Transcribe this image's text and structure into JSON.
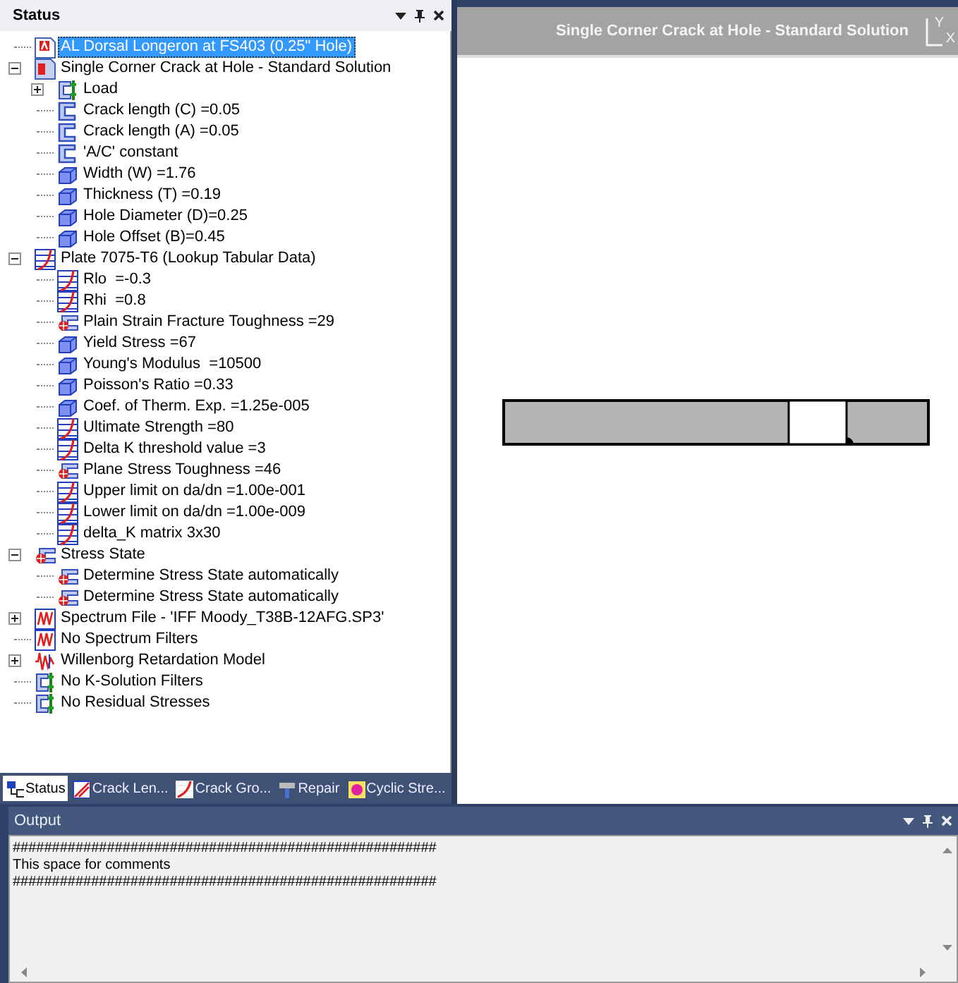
{
  "status_panel": {
    "title": "Status",
    "tree": [
      {
        "label": "AL Dorsal Longeron at FS403 (0.25\" Hole)",
        "kind": "document",
        "selected": true
      },
      {
        "label": "Single Corner Crack at Hole - Standard Solution",
        "kind": "solution",
        "selected": false,
        "expanded": true,
        "children": [
          {
            "label": "Load",
            "kind": "load",
            "selected": false,
            "expanded": false
          },
          {
            "label": "Crack length (C) =0.05",
            "kind": "crack",
            "selected": false
          },
          {
            "label": "Crack length (A) =0.05",
            "kind": "crack",
            "selected": false
          },
          {
            "label": "'A/C' constant",
            "kind": "crack",
            "selected": false
          },
          {
            "label": "Width (W) =1.76",
            "kind": "cube",
            "selected": false
          },
          {
            "label": "Thickness (T) =0.19",
            "kind": "cube",
            "selected": false
          },
          {
            "label": "Hole Diameter (D)=0.25",
            "kind": "cube",
            "selected": false
          },
          {
            "label": "Hole Offset (B)=0.45",
            "kind": "cube",
            "selected": false
          }
        ]
      },
      {
        "label": "Plate 7075-T6 (Lookup Tabular Data)",
        "kind": "curve",
        "selected": false,
        "expanded": true,
        "children": [
          {
            "label": "Rlo  =-0.3",
            "kind": "curve",
            "selected": false
          },
          {
            "label": "Rhi  =0.8",
            "kind": "curve",
            "selected": false
          },
          {
            "label": "Plain Strain Fracture Toughness =29",
            "kind": "stress",
            "selected": false
          },
          {
            "label": "Yield Stress =67",
            "kind": "cube",
            "selected": false
          },
          {
            "label": "Young's Modulus  =10500",
            "kind": "cube",
            "selected": false
          },
          {
            "label": "Poisson's Ratio =0.33",
            "kind": "cube",
            "selected": false
          },
          {
            "label": "Coef. of Therm. Exp. =1.25e-005",
            "kind": "cube",
            "selected": false
          },
          {
            "label": "Ultimate Strength =80",
            "kind": "curve",
            "selected": false
          },
          {
            "label": "Delta K threshold value =3",
            "kind": "curve",
            "selected": false
          },
          {
            "label": "Plane Stress Toughness =46",
            "kind": "stress",
            "selected": false
          },
          {
            "label": "Upper limit on da/dn =1.00e-001",
            "kind": "curve",
            "selected": false
          },
          {
            "label": "Lower limit on da/dn =1.00e-009",
            "kind": "curve",
            "selected": false
          },
          {
            "label": "delta_K matrix 3x30",
            "kind": "curve",
            "selected": false
          }
        ]
      },
      {
        "label": "Stress State",
        "kind": "stress",
        "selected": false,
        "expanded": true,
        "children": [
          {
            "label": "Determine Stress State automatically",
            "kind": "stress",
            "selected": false
          },
          {
            "label": "Determine Stress State automatically",
            "kind": "stress",
            "selected": false
          }
        ]
      },
      {
        "label": "Spectrum File - 'IFF Moody_T38B-12AFG.SP3'",
        "kind": "spectrum",
        "selected": false,
        "expanded": false
      },
      {
        "label": "No Spectrum Filters",
        "kind": "spectrum",
        "selected": false
      },
      {
        "label": "Willenborg Retardation Model",
        "kind": "wave",
        "selected": false,
        "expanded": false
      },
      {
        "label": "No K-Solution Filters",
        "kind": "load",
        "selected": false
      },
      {
        "label": "No Residual Stresses",
        "kind": "load",
        "selected": false
      }
    ]
  },
  "tabs": [
    {
      "label": "Status",
      "kind": "network",
      "selected": true
    },
    {
      "label": "Crack Len...",
      "kind": "crack",
      "selected": false
    },
    {
      "label": "Crack Gro...",
      "kind": "curve",
      "selected": false
    },
    {
      "label": "Repair",
      "kind": "repair",
      "selected": false
    },
    {
      "label": "Cyclic Stre...",
      "kind": "cyclic",
      "selected": false
    }
  ],
  "view": {
    "title": "Single Corner Crack at Hole - Standard Solution",
    "axis_labels": [
      "Y",
      "X"
    ]
  },
  "output": {
    "title": "Output",
    "lines": [
      "######################################################",
      "This space for comments",
      "######################################################"
    ]
  }
}
